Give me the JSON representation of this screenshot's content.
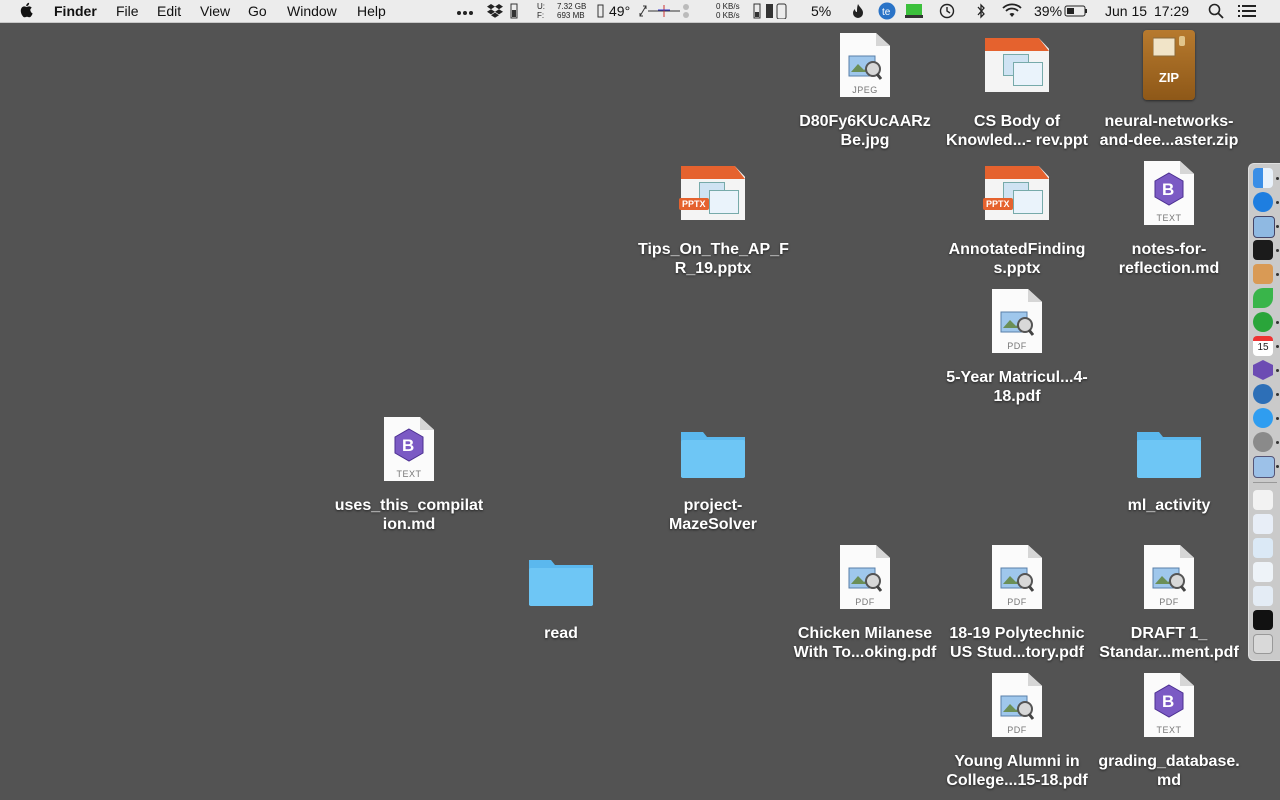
{
  "menubar": {
    "app_name": "Finder",
    "menus": [
      "File",
      "Edit",
      "View",
      "Go",
      "Window",
      "Help"
    ],
    "storage": {
      "u_label": "U:",
      "f_label": "F:",
      "used": "7.32 GB",
      "free": "693 MB"
    },
    "temperature": "49°",
    "network": {
      "up": "0 KB/s",
      "down": "0 KB/s"
    },
    "cpu_percent": "5%",
    "battery_percent": "39%",
    "date": "Jun 15",
    "time": "17:29"
  },
  "desktop": {
    "icons": [
      {
        "label": "D80Fy6KUcAARz Be.jpg",
        "kind": "preview",
        "ext": "JPEG"
      },
      {
        "label": "CS Body of Knowled...- rev.ppt",
        "kind": "ppt",
        "ext": ""
      },
      {
        "label": "neural-networks- and-dee...aster.zip",
        "kind": "zip",
        "ext": "ZIP"
      },
      {
        "label": "Tips_On_The_AP_F R_19.pptx",
        "kind": "ppt",
        "ext": "PPTX"
      },
      {
        "label": "AnnotatedFinding s.pptx",
        "kind": "ppt",
        "ext": "PPTX"
      },
      {
        "label": "notes-for- reflection.md",
        "kind": "bbedit",
        "ext": "TEXT"
      },
      {
        "label": "5-Year Matricul...4-18.pdf",
        "kind": "preview",
        "ext": "PDF"
      },
      {
        "label": "uses_this_compilat ion.md",
        "kind": "bbedit",
        "ext": "TEXT"
      },
      {
        "label": "project- MazeSolver",
        "kind": "folder",
        "ext": ""
      },
      {
        "label": "ml_activity",
        "kind": "folder",
        "ext": ""
      },
      {
        "label": "read",
        "kind": "folder",
        "ext": ""
      },
      {
        "label": "Chicken Milanese With To...oking.pdf",
        "kind": "preview",
        "ext": "PDF"
      },
      {
        "label": "18-19 Polytechnic US Stud...tory.pdf",
        "kind": "preview",
        "ext": "PDF"
      },
      {
        "label": "DRAFT 1_ Standar...ment.pdf",
        "kind": "preview",
        "ext": "PDF"
      },
      {
        "label": "Young Alumni in College...15-18.pdf",
        "kind": "preview",
        "ext": "PDF"
      },
      {
        "label": "grading_database. md",
        "kind": "bbedit",
        "ext": "TEXT"
      }
    ]
  },
  "dock": {
    "calendar_day": "15",
    "apps": [
      "finder",
      "safari",
      "preview",
      "terminal",
      "photo",
      "leaf",
      "leaves",
      "calendar",
      "bbedit",
      "tweetbot",
      "messages",
      "settings",
      "preview2"
    ],
    "docs": [
      "doc1",
      "doc2",
      "doc3",
      "doc4",
      "doc5",
      "activity",
      "trash"
    ]
  },
  "colors": {
    "desktop_bg": "#535353",
    "folder_blue": "#6ec6f5",
    "ppt_orange": "#e5622e",
    "zip_brown": "#a86a24",
    "bbedit_purple": "#6c4bb3"
  }
}
